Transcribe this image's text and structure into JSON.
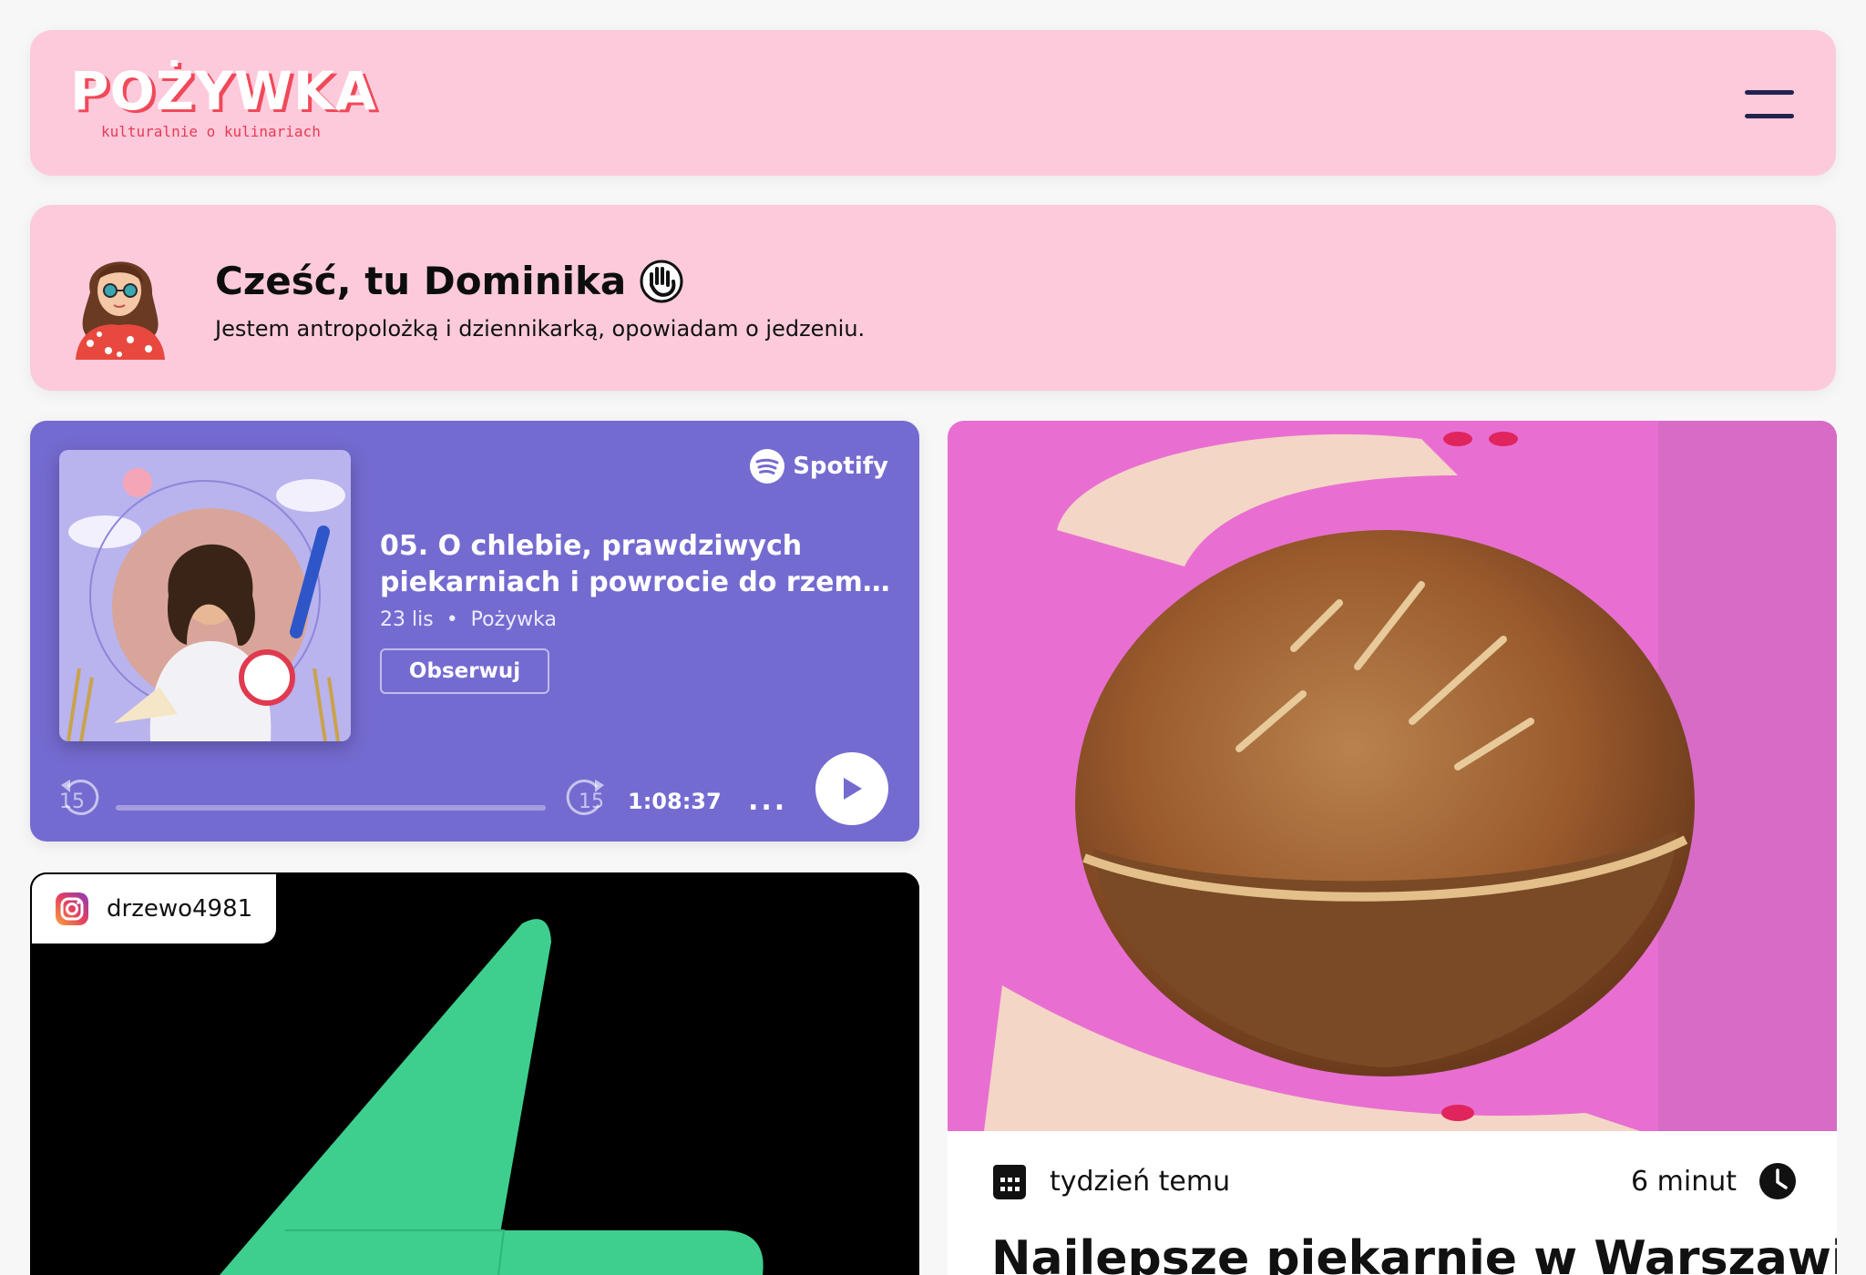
{
  "header": {
    "logo_text": "POŻYWKA",
    "tagline": "kulturalnie o kulinariach",
    "menu_icon": "hamburger-icon"
  },
  "intro": {
    "title": "Cześć, tu Dominika",
    "wave_icon": "waving-hand-icon",
    "text": "Jestem antropolożką i dziennikarką, opowiadam o jedzeniu."
  },
  "spotify": {
    "brand": "Spotify",
    "episode_title_line1": "05. O chlebie, prawdziwych",
    "episode_title_line2": "piekarniach i powrocie do rzemiosł...",
    "date": "23 lis",
    "separator": "•",
    "show": "Pożywka",
    "follow_label": "Obserwuj",
    "rewind_label": "15",
    "forward_label": "15",
    "progress_fraction": 0.0,
    "duration": "1:08:37",
    "more_label": "...",
    "accent": "#746bd1"
  },
  "instagram": {
    "username": "drzewo4981",
    "icon": "instagram-icon"
  },
  "article": {
    "date_icon": "calendar-icon",
    "date": "tydzień temu",
    "read_time": "6 minut",
    "clock_icon": "clock-icon",
    "title": "Najlepsze piekarnie w Warszawie –"
  },
  "colors": {
    "pink": "#fccadb",
    "logo_red": "#f0495a",
    "navy": "#232350",
    "insta_green": "#3ecf8e"
  }
}
